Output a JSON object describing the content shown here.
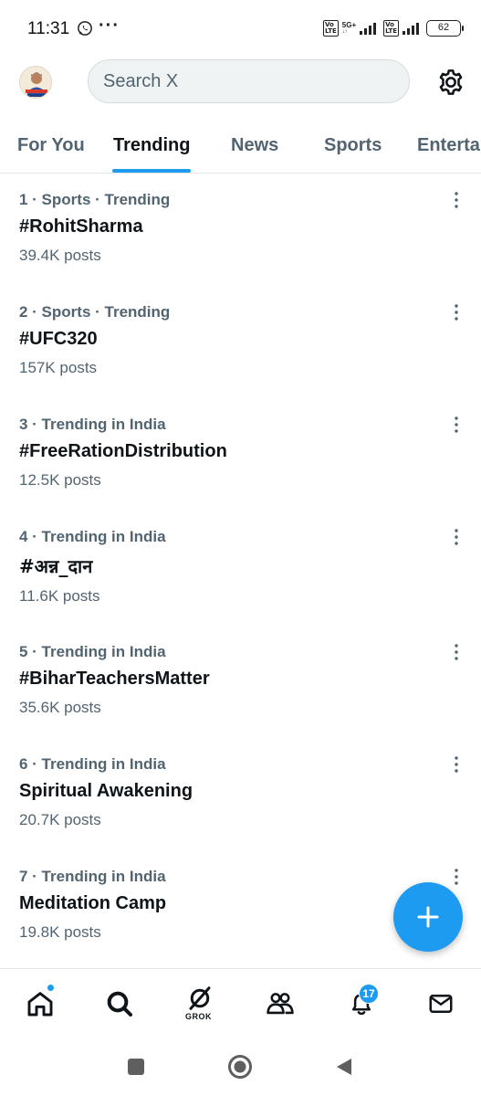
{
  "status_bar": {
    "time": "11:31",
    "dots": "···",
    "sim1_label": "5G+",
    "volte_label": "Vo\nLTE",
    "battery": "62"
  },
  "header": {
    "search_placeholder": "Search X"
  },
  "tabs": [
    {
      "label": "For You",
      "active": false
    },
    {
      "label": "Trending",
      "active": true
    },
    {
      "label": "News",
      "active": false
    },
    {
      "label": "Sports",
      "active": false
    },
    {
      "label": "Enterta",
      "active": false
    }
  ],
  "trends": [
    {
      "meta": "1 · Sports · Trending",
      "name": "#RohitSharma",
      "posts": "39.4K posts"
    },
    {
      "meta": "2 · Sports · Trending",
      "name": "#UFC320",
      "posts": "157K posts"
    },
    {
      "meta": "3 · Trending in India",
      "name": "#FreeRationDistribution",
      "posts": "12.5K posts"
    },
    {
      "meta": "4 · Trending in India",
      "name": "#अन्न_दान",
      "posts": "11.6K posts"
    },
    {
      "meta": "5 · Trending in India",
      "name": "#BiharTeachersMatter",
      "posts": "35.6K posts"
    },
    {
      "meta": "6 · Trending in India",
      "name": "Spiritual Awakening",
      "posts": "20.7K posts"
    },
    {
      "meta": "7 · Trending in India",
      "name": "Meditation Camp",
      "posts": "19.8K posts"
    }
  ],
  "bottom_nav": {
    "grok_label": "GROK",
    "notification_count": "17",
    "items": [
      "home-icon",
      "search-icon",
      "grok-icon",
      "communities-icon",
      "notifications-icon",
      "messages-icon"
    ]
  },
  "colors": {
    "accent": "#1d9bf0",
    "text_primary": "#0f1419",
    "text_secondary": "#536471"
  }
}
